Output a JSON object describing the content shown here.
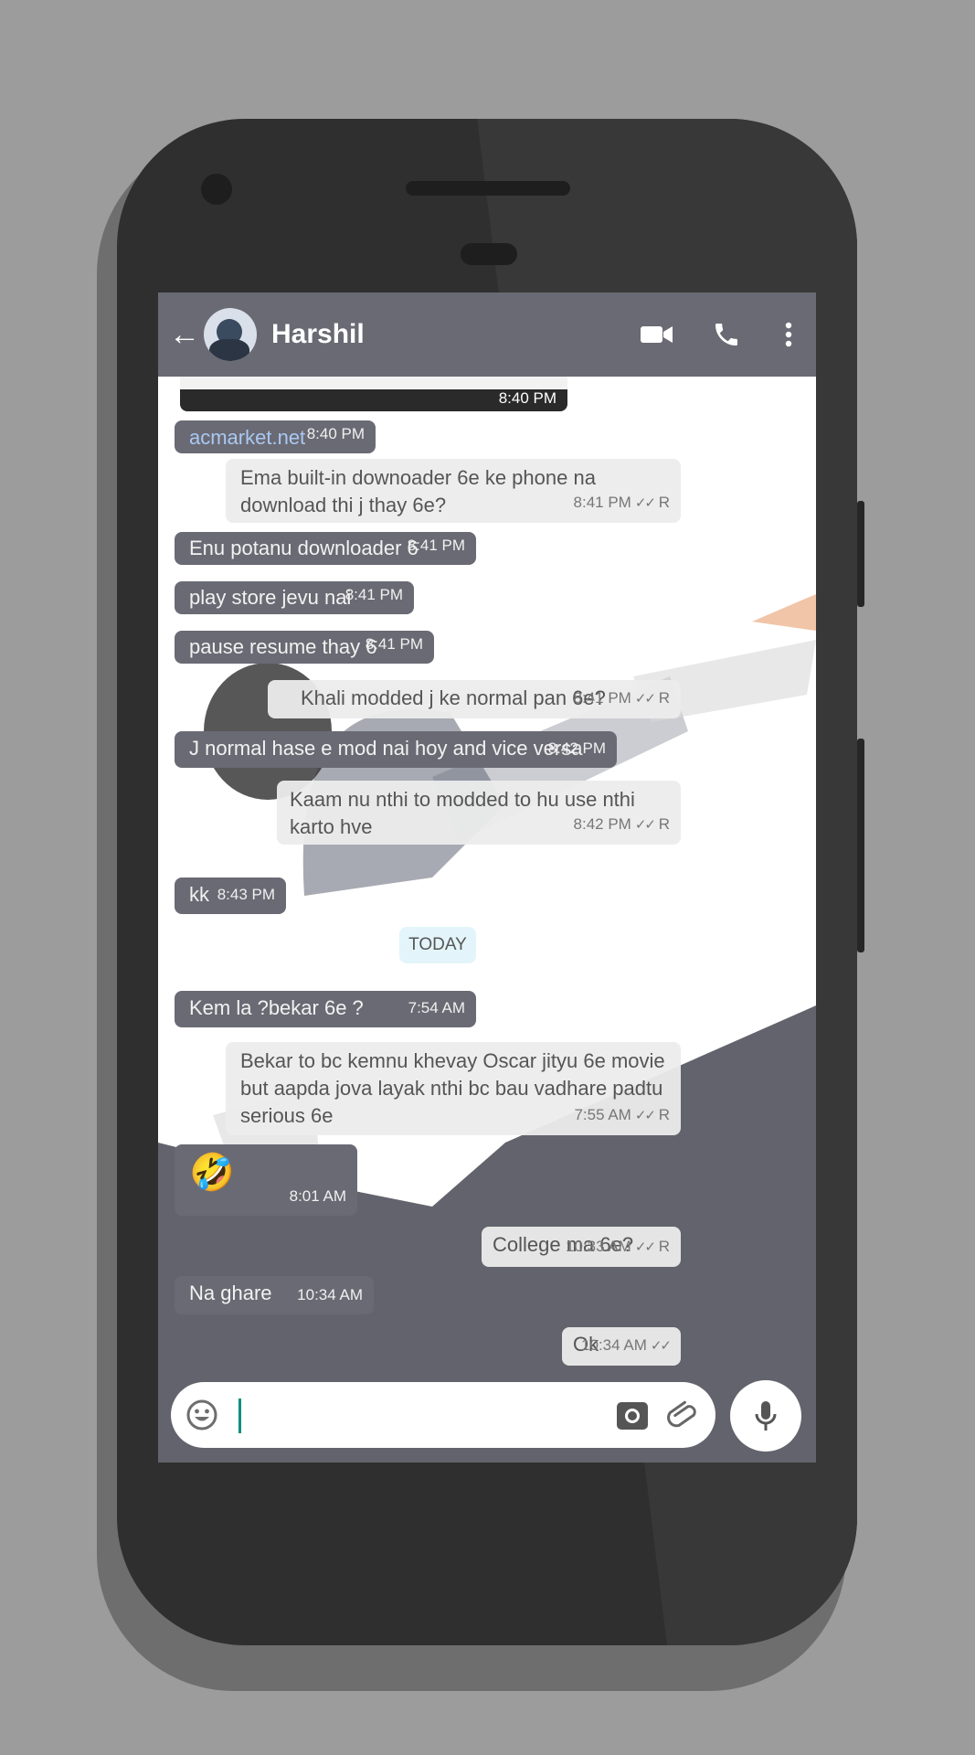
{
  "header": {
    "contact_name": "Harshil"
  },
  "attachment_preview": {
    "time": "8:40 PM"
  },
  "messages": [
    {
      "id": "m1",
      "dir": "in",
      "text": "acmarket.net",
      "is_link": true,
      "time": "8:40 PM"
    },
    {
      "id": "m2",
      "dir": "out",
      "text": "Ema built-in downoader 6e ke phone na download thi j thay 6e?",
      "time": "8:41 PM",
      "status": "R"
    },
    {
      "id": "m3",
      "dir": "in",
      "text": "Enu potanu downloader 6",
      "time": "8:41 PM"
    },
    {
      "id": "m4",
      "dir": "in",
      "text": "play store jevu nai",
      "time": "8:41 PM"
    },
    {
      "id": "m5",
      "dir": "in",
      "text": "pause resume thay 6",
      "time": "8:41 PM"
    },
    {
      "id": "m6",
      "dir": "out",
      "text": "Khali modded j ke normal pan 6e?",
      "time": "8:41 PM",
      "status": "R"
    },
    {
      "id": "m7",
      "dir": "in",
      "text": "J normal hase e mod nai hoy and vice versa",
      "time": "8:42 PM"
    },
    {
      "id": "m8",
      "dir": "out",
      "text": "Kaam nu nthi to modded to hu use nthi karto hve",
      "time": "8:42 PM",
      "status": "R"
    },
    {
      "id": "m9",
      "dir": "in",
      "text": "kk",
      "time": "8:43 PM"
    },
    {
      "id": "m10",
      "dir": "in",
      "text": "Kem la ?bekar 6e ?",
      "time": "7:54 AM"
    },
    {
      "id": "m11",
      "dir": "out",
      "text": "Bekar to bc kemnu khevay Oscar jityu 6e movie but aapda jova layak nthi bc bau vadhare padtu serious 6e",
      "time": "7:55 AM",
      "status": "R"
    },
    {
      "id": "m12",
      "dir": "in",
      "text": "🤣",
      "time": "8:01 AM"
    },
    {
      "id": "m13",
      "dir": "out",
      "text": "College ma 6e?",
      "time": "10:33 AM",
      "status": "R"
    },
    {
      "id": "m14",
      "dir": "in",
      "text": "Na ghare",
      "time": "10:34 AM"
    },
    {
      "id": "m15",
      "dir": "out",
      "text": "Ok",
      "time": "10:34 AM",
      "status": ""
    }
  ],
  "day_separator": "TODAY",
  "composer": {
    "value": "",
    "placeholder": ""
  },
  "colors": {
    "appbar": "#6a6a74",
    "incoming_bubble": "#6a6a74",
    "outgoing_bubble": "#ececec",
    "link": "#a9c8f2",
    "cursor": "#0a8f82"
  }
}
